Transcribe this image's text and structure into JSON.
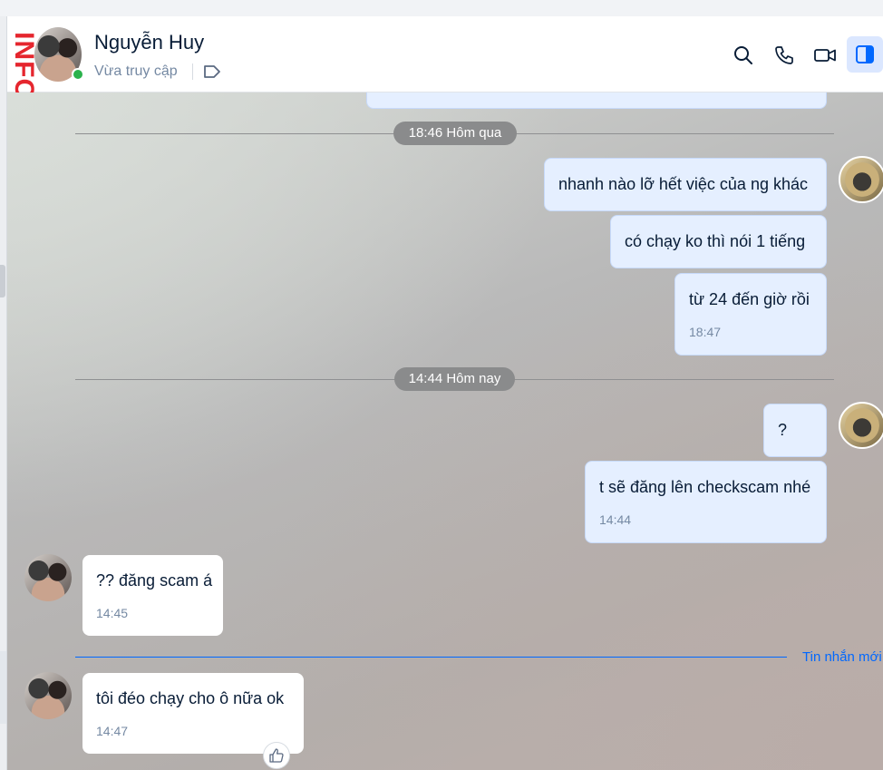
{
  "header": {
    "logo_text": "INFO",
    "contact_name": "Nguyễn Huy",
    "status": "Vừa truy cập",
    "icons": [
      "search-icon",
      "phone-icon",
      "video-call-icon",
      "sidebar-toggle-icon",
      "tag-icon"
    ]
  },
  "colors": {
    "accent": "#0068ff",
    "my_bubble": "#e5efff",
    "their_bubble": "#ffffff",
    "online": "#2bb24c"
  },
  "chat": {
    "day_1": "18:46 Hôm qua",
    "day_2": "14:44 Hôm nay",
    "new_messages_label": "Tin nhắn mới",
    "messages": [
      {
        "from": "me",
        "text": "nhanh nào lỡ hết việc của ng khác",
        "time": ""
      },
      {
        "from": "me",
        "text": "có chạy ko thì nói 1 tiếng",
        "time": ""
      },
      {
        "from": "me",
        "text": "từ 24 đến giờ rồi",
        "time": "18:47"
      },
      {
        "from": "me",
        "text": "?",
        "time": ""
      },
      {
        "from": "me",
        "text": "t sẽ đăng lên checkscam nhé",
        "time": "14:44"
      },
      {
        "from": "them",
        "text": "?? đăng scam á",
        "time": "14:45"
      },
      {
        "from": "them",
        "text": "tôi đéo chạy cho ô nữa ok",
        "time": "14:47"
      }
    ]
  }
}
